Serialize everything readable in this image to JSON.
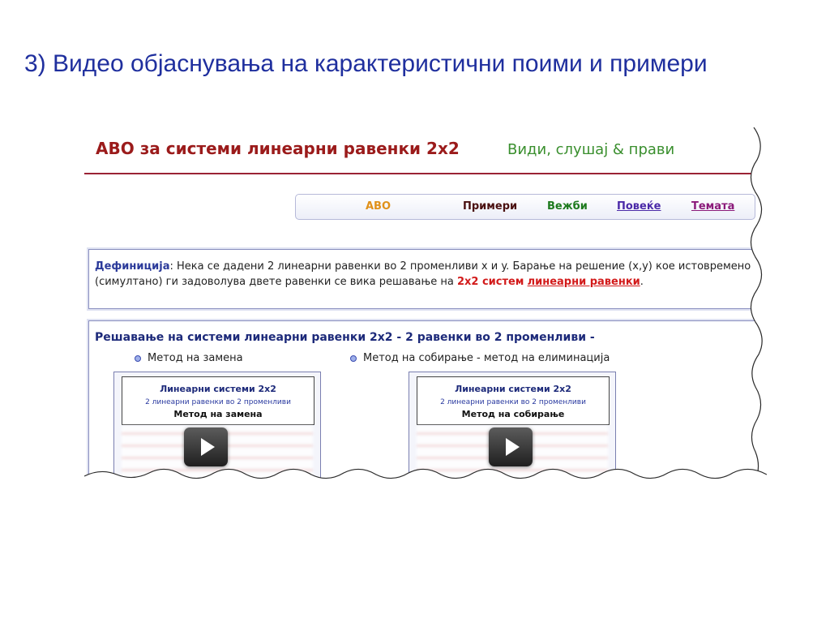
{
  "slide": {
    "title": "3) Видео објаснувања на карактеристични поими и примери"
  },
  "site": {
    "title": "АВО за системи линеарни равенки 2x2",
    "tagline": "Види, слушај & прави"
  },
  "nav": {
    "items": [
      "АВО",
      "Примери",
      "Вежби",
      "Повеќе",
      "Темата"
    ]
  },
  "definition": {
    "term": "Дефиниција",
    "text": ": Нека се дадени 2 линеарни равенки во 2 променливи x и y. Барање на решение (x,y) кое истовремено (симултано) ги задоволува двете равенки се вика решавање на ",
    "highlight": "2x2 систем",
    "link": "линеарни равенки",
    "end": "."
  },
  "solving": {
    "heading": "Решавање на системи линеарни равенки 2x2 - 2 равенки во 2 променливи -",
    "methods": [
      "Метод на замена",
      "Метод на собирање - метод на елиминација"
    ],
    "videos": [
      {
        "title": "Линеарни системи 2x2",
        "subtitle": "2 линеарни равенки во 2 променливи",
        "method": "Метод на замена"
      },
      {
        "title": "Линеарни системи 2x2",
        "subtitle": "2 линеарни равенки во 2 променливи",
        "method": "Метод на собирање"
      }
    ]
  },
  "icons": {
    "play": "play-icon",
    "bullet": "bullet-icon"
  },
  "colors": {
    "title": "#1f2f9e",
    "site_title": "#9b1b1b",
    "tagline": "#3a8f2e",
    "accent_red": "#d21a1a"
  }
}
